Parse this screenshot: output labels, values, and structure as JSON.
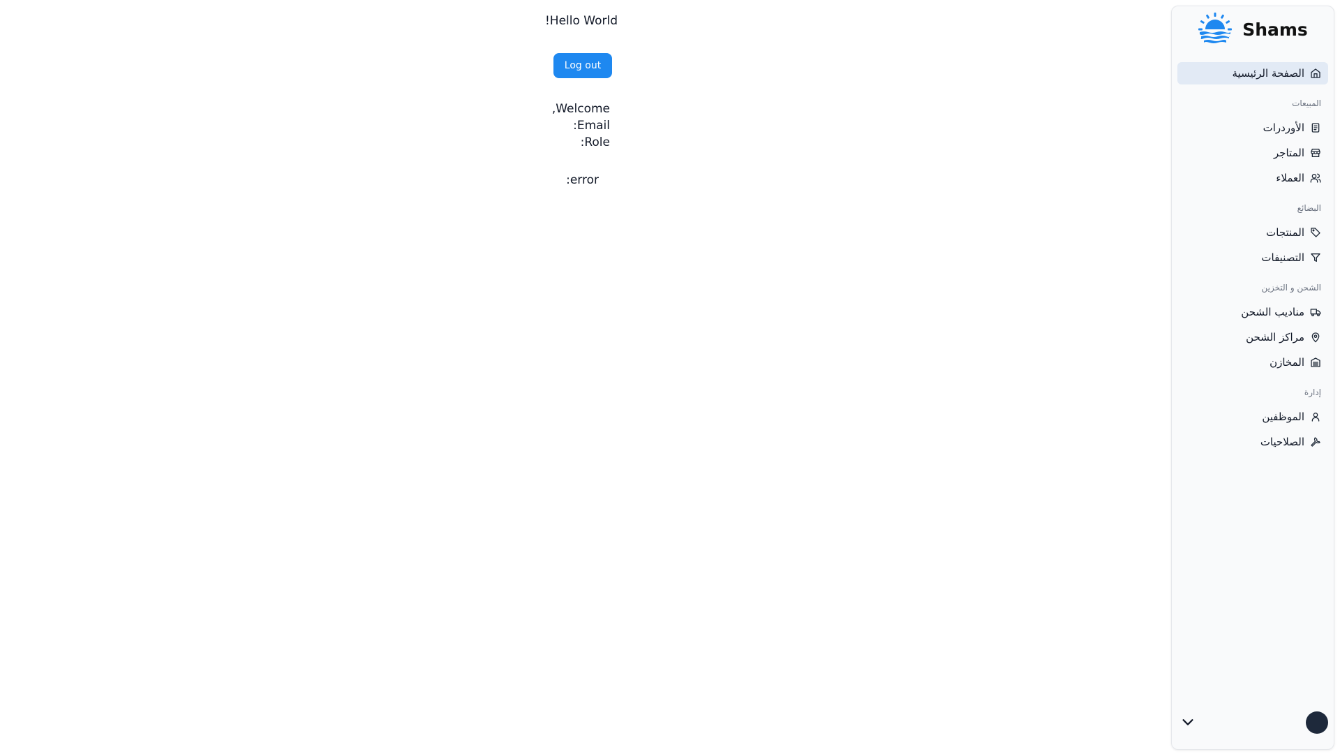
{
  "main": {
    "greeting": "Hello World!",
    "logout_label": "Log out",
    "welcome": "Welcome,",
    "email": "Email:",
    "role": "Role:",
    "error": "error:"
  },
  "sidebar": {
    "brand": "Shams",
    "brand_color": "#1e88f0",
    "home": "الصفحة الرئيسية",
    "groups": {
      "sales": "المبيعات",
      "goods": "البضائع",
      "shipping": "الشحن و التخزين",
      "admin": "إدارة"
    },
    "items": {
      "orders": "الأوردرات",
      "stores": "المتاجر",
      "customers": "العملاء",
      "products": "المنتجات",
      "categories": "التصنيفات",
      "couriers": "مناديب الشحن",
      "shipping_centers": "مراكز الشحن",
      "warehouses": "المخازن",
      "employees": "الموظفين",
      "permissions": "الصلاحيات"
    }
  }
}
